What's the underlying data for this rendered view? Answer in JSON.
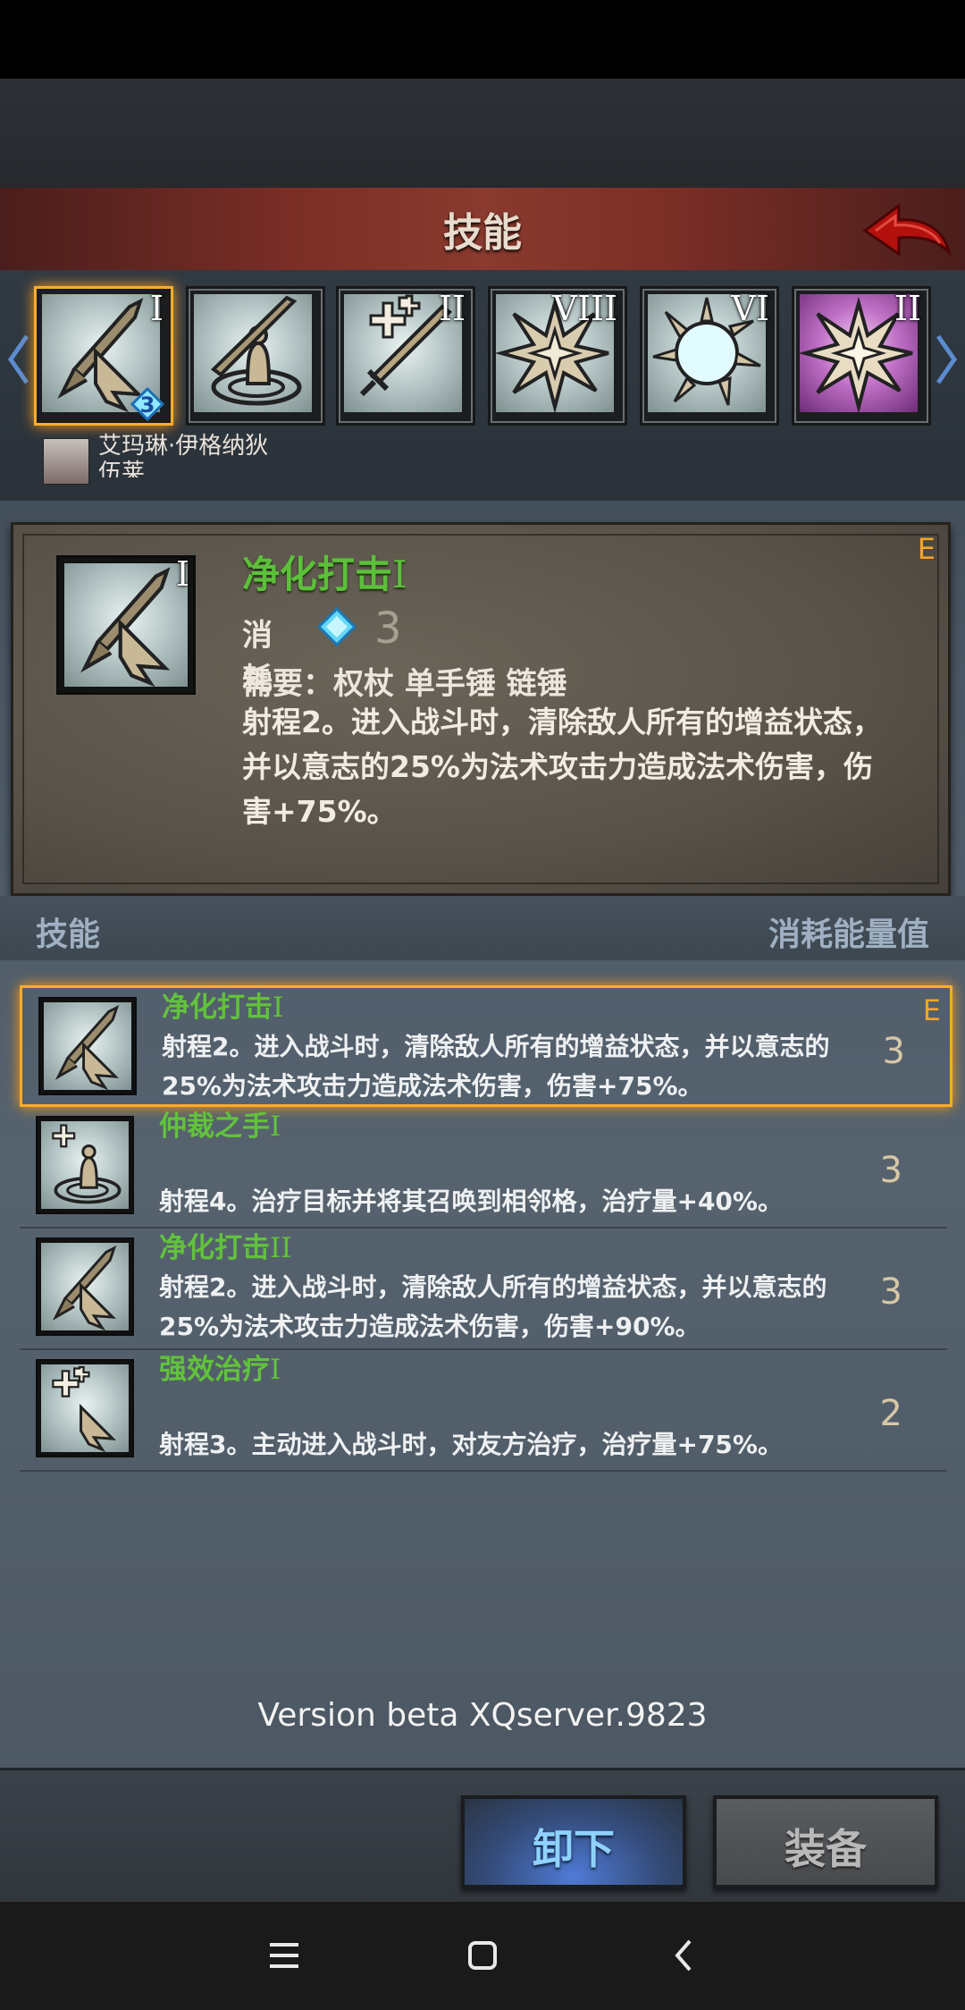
{
  "header": {
    "title": "技能"
  },
  "skill_slots": [
    {
      "name": "净化打击",
      "tier": "I",
      "icon": "spear-strike-icon",
      "selected": true,
      "badge": "3"
    },
    {
      "name": "仲裁之手",
      "tier": "",
      "icon": "sword-summon-icon"
    },
    {
      "name": "强效治疗",
      "tier": "II",
      "icon": "cross-sword-icon"
    },
    {
      "name": "burst-8",
      "tier": "VIII",
      "icon": "explosion-icon"
    },
    {
      "name": "burst-6",
      "tier": "VI",
      "icon": "shatter-icon"
    },
    {
      "name": "burst-purple",
      "tier": "II",
      "icon": "purple-explosion-icon"
    }
  ],
  "character": {
    "name": "艾玛琳·伊格纳狄 伍莱"
  },
  "detail": {
    "name": "净化打击",
    "tier": "I",
    "grade": "E",
    "cost_label": "消耗",
    "cost_value": "3",
    "requirement": "需要：权杖 单手锤 链锤",
    "description": "射程2。进入战斗时，清除敌人所有的增益状态，并以意志的25%为法术攻击力造成法术伤害，伤害+75%。"
  },
  "list_header": {
    "left": "技能",
    "right": "消耗能量值"
  },
  "skills": [
    {
      "name": "净化打击",
      "tier": "I",
      "grade": "E",
      "desc": "射程2。进入战斗时，清除敌人所有的增益状态，并以意志的25%为法术攻击力造成法术伤害，伤害+75%。",
      "cost": "3"
    },
    {
      "name": "仲裁之手",
      "tier": "I",
      "grade": "",
      "desc": "射程4。治疗目标并将其召唤到相邻格，治疗量+40%。",
      "cost": "3"
    },
    {
      "name": "净化打击",
      "tier": "II",
      "grade": "",
      "desc": "射程2。进入战斗时，清除敌人所有的增益状态，并以意志的25%为法术攻击力造成法术伤害，伤害+90%。",
      "cost": "3"
    },
    {
      "name": "强效治疗",
      "tier": "I",
      "grade": "",
      "desc": "射程3。主动进入战斗时，对友方治疗，治疗量+75%。",
      "cost": "2"
    }
  ],
  "version": "Version beta XQserver.9823",
  "buttons": {
    "unequip": "卸下",
    "equip": "装备"
  },
  "colors": {
    "accent": "#ffae2a",
    "skill_name": "#5cc03a",
    "grade": "#f3a52a"
  }
}
